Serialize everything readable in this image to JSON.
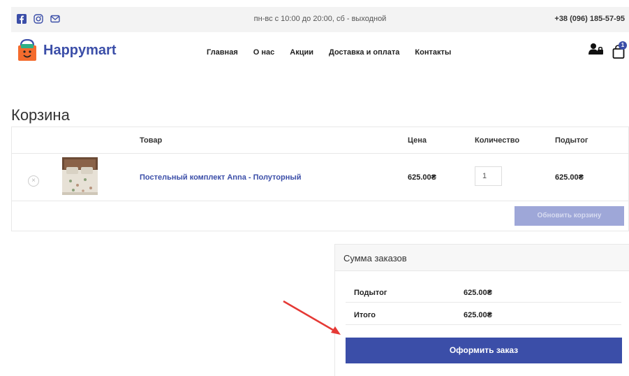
{
  "topbar": {
    "social_icons": [
      "facebook-icon",
      "instagram-icon",
      "mail-icon"
    ],
    "hours": "пн-вс с 10:00 до 20:00, сб - выходной",
    "phone": "+38 (096) 185-57-95"
  },
  "header": {
    "logo_text": "Happymart",
    "nav": [
      "Главная",
      "О нас",
      "Акции",
      "Доставка и оплата",
      "Контакты"
    ],
    "cart_count": "1"
  },
  "cart": {
    "title": "Корзина",
    "columns": {
      "product": "Товар",
      "price": "Цена",
      "quantity": "Количество",
      "subtotal": "Подытог"
    },
    "item": {
      "remove": "×",
      "name": "Постельный комплект Anna - Полуторный",
      "price": "625.00₴",
      "quantity": "1",
      "subtotal": "625.00₴"
    },
    "update_button": "Обновить корзину"
  },
  "totals": {
    "title": "Сумма заказов",
    "subtotal_label": "Подытог",
    "subtotal_value": "625.00₴",
    "total_label": "Итого",
    "total_value": "625.00₴",
    "checkout_button": "Оформить заказ"
  },
  "colors": {
    "brand": "#3b4ea8",
    "button_disabled": "#9ea7d8",
    "arrow": "#e53935"
  }
}
